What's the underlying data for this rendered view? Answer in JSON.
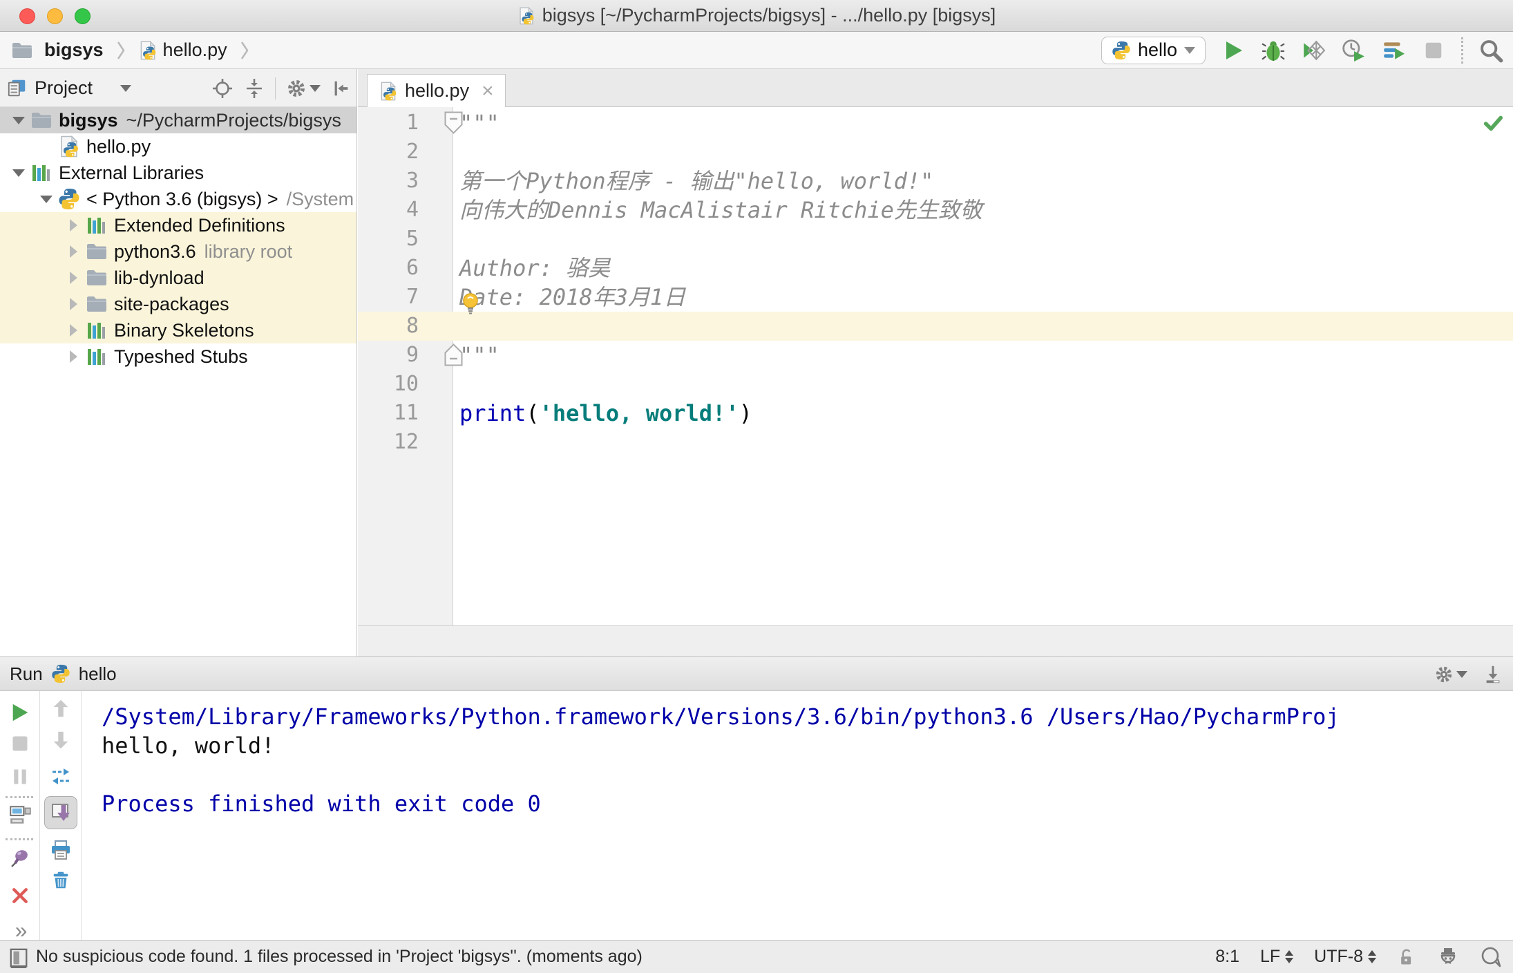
{
  "window": {
    "title": "bigsys [~/PycharmProjects/bigsys] - .../hello.py [bigsys]"
  },
  "navbar": {
    "breadcrumbs": [
      "bigsys",
      "hello.py"
    ],
    "run_config": {
      "label": "hello"
    },
    "toolbar_icons": [
      "run",
      "debug",
      "run-with-coverage",
      "profile",
      "concurrency-diagram",
      "stop",
      "search-everywhere"
    ]
  },
  "project_panel": {
    "header": {
      "title": "Project",
      "icons": [
        "locate",
        "collapse-all",
        "settings",
        "hide-panel"
      ]
    },
    "tree": [
      {
        "label": "bigsys",
        "suffix": "~/PycharmProjects/bigsys",
        "suffix_style": "dark",
        "icon": "folder",
        "expand": "open",
        "level": 0,
        "state": "selected",
        "bold": true
      },
      {
        "label": "hello.py",
        "icon": "python-file",
        "expand": "none",
        "level": 1
      },
      {
        "label": "External Libraries",
        "icon": "library",
        "expand": "open",
        "level": 0
      },
      {
        "label": "< Python 3.6 (bigsys) >",
        "suffix": "/System",
        "icon": "python",
        "expand": "open",
        "level": 1
      },
      {
        "label": "Extended Definitions",
        "icon": "library",
        "expand": "closed",
        "level": 2,
        "state": "highlighted"
      },
      {
        "label": "python3.6",
        "suffix": "library root",
        "icon": "folder",
        "expand": "closed",
        "level": 2,
        "state": "highlighted"
      },
      {
        "label": "lib-dynload",
        "icon": "folder",
        "expand": "closed",
        "level": 2,
        "state": "highlighted"
      },
      {
        "label": "site-packages",
        "icon": "folder",
        "expand": "closed",
        "level": 2,
        "state": "highlighted"
      },
      {
        "label": "Binary Skeletons",
        "icon": "library",
        "expand": "closed",
        "level": 2,
        "state": "highlighted"
      },
      {
        "label": "Typeshed Stubs",
        "icon": "library",
        "expand": "closed",
        "level": 2
      }
    ]
  },
  "editor": {
    "tab": {
      "label": "hello.py",
      "close": "×"
    },
    "lines": [
      {
        "n": 1,
        "segments": [
          {
            "text": "\"\"\"",
            "style": "doc"
          }
        ],
        "fold": "start"
      },
      {
        "n": 2,
        "segments": []
      },
      {
        "n": 3,
        "segments": [
          {
            "text": "第一个Python程序 - 输出\"hello, world!\"",
            "style": "doc"
          }
        ]
      },
      {
        "n": 4,
        "segments": [
          {
            "text": "向伟大的Dennis MacAlistair Ritchie先生致敬",
            "style": "doc"
          }
        ]
      },
      {
        "n": 5,
        "segments": []
      },
      {
        "n": 6,
        "segments": [
          {
            "text": "Author: 骆昊",
            "style": "doc"
          }
        ]
      },
      {
        "n": 7,
        "segments": [
          {
            "text": "Date: 2018年3月1日",
            "style": "doc"
          }
        ],
        "bulb": true
      },
      {
        "n": 8,
        "segments": [],
        "current": true
      },
      {
        "n": 9,
        "segments": [
          {
            "text": "\"\"\"",
            "style": "doc"
          }
        ],
        "fold": "end"
      },
      {
        "n": 10,
        "segments": []
      },
      {
        "n": 11,
        "segments": [
          {
            "text": "print",
            "style": "keyword"
          },
          {
            "text": "(",
            "style": "plain"
          },
          {
            "text": "'hello, world!'",
            "style": "string"
          },
          {
            "text": ")",
            "style": "plain"
          }
        ]
      },
      {
        "n": 12,
        "segments": []
      }
    ],
    "inspection_status": "ok"
  },
  "run_panel": {
    "title": "Run",
    "config": "hello",
    "header_icons": [
      "settings",
      "hide-down"
    ],
    "toolbar_left": [
      "rerun",
      "stop",
      "pause",
      "show-layouts",
      "pin",
      "close",
      "more"
    ],
    "toolbar_right": [
      "up-stack-trace",
      "down-stack-trace",
      "restore-layout",
      "scroll-to-end",
      "print",
      "clear-all"
    ],
    "more_label": "»",
    "console_lines": [
      {
        "text": "/System/Library/Frameworks/Python.framework/Versions/3.6/bin/python3.6 /Users/Hao/PycharmProj",
        "style": "system"
      },
      {
        "text": "hello, world!",
        "style": "stdout"
      },
      {
        "text": "",
        "style": "stdout"
      },
      {
        "text": "Process finished with exit code 0",
        "style": "system"
      }
    ]
  },
  "status_bar": {
    "message": "No suspicious code found. 1 files processed in 'Project 'bigsys''. (moments ago)",
    "cursor_position": "8:1",
    "line_separator": "LF",
    "encoding": "UTF-8",
    "icons": [
      "toolwindow-toggle",
      "readonly-lock",
      "hector-inspector",
      "event-log-bubble"
    ]
  },
  "colors": {
    "accent_green": "#4da651",
    "selection_gray": "#d2d2d2",
    "library_highlight": "#faf5da",
    "current_line": "#fcf6de",
    "console_system_text": "#0000a8",
    "string_teal": "#067d7b",
    "keyword_blue": "#0000b2"
  }
}
